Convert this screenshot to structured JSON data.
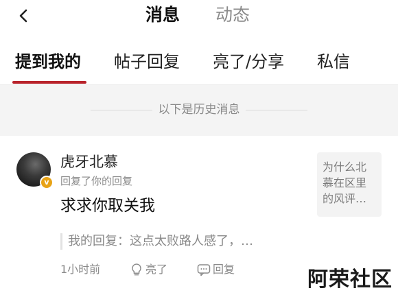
{
  "header": {
    "back_icon": "chevron-left-icon",
    "tabs": [
      {
        "label": "消息",
        "active": true
      },
      {
        "label": "动态",
        "active": false
      }
    ]
  },
  "subtabs": [
    {
      "label": "提到我的",
      "active": true
    },
    {
      "label": "帖子回复",
      "active": false
    },
    {
      "label": "亮了/分享",
      "active": false
    },
    {
      "label": "私信",
      "active": false
    }
  ],
  "accent_color": "#b8232b",
  "history": {
    "label": "以下是历史消息"
  },
  "message": {
    "username": "虎牙北慕",
    "badge": "v",
    "meta": "回复了你的回复",
    "content": "求求你取关我",
    "quote": "我的回复：这点太败路人感了，…",
    "thread_preview": "为什么北慕在区里的风评…",
    "time": "1小时前",
    "like_label": "亮了",
    "reply_label": "回复"
  },
  "watermark": "阿荣社区"
}
